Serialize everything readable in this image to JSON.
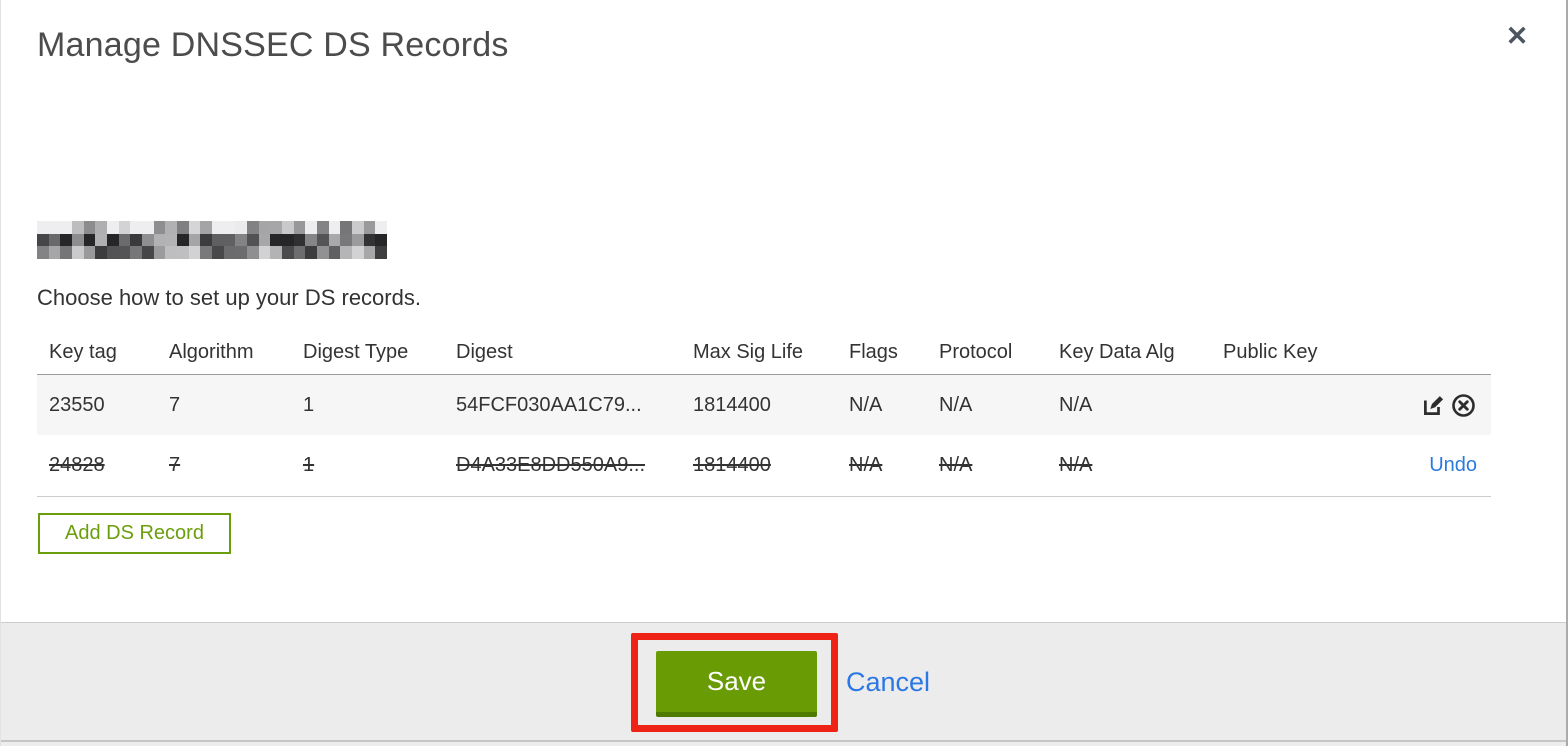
{
  "dialog": {
    "title": "Manage DNSSEC DS Records",
    "close_icon": "close",
    "subtitle": "Choose how to set up your DS records."
  },
  "table": {
    "columns": [
      "Key tag",
      "Algorithm",
      "Digest Type",
      "Digest",
      "Max Sig Life",
      "Flags",
      "Protocol",
      "Key Data Alg",
      "Public Key"
    ],
    "rows": [
      {
        "key_tag": "23550",
        "algorithm": "7",
        "digest_type": "1",
        "digest": "54FCF030AA1C79...",
        "max_sig_life": "1814400",
        "flags": "N/A",
        "protocol": "N/A",
        "key_data_alg": "N/A",
        "public_key": "",
        "state": "normal",
        "actions": [
          "edit",
          "delete"
        ]
      },
      {
        "key_tag": "24828",
        "algorithm": "7",
        "digest_type": "1",
        "digest": "D4A33E8DD550A9...",
        "max_sig_life": "1814400",
        "flags": "N/A",
        "protocol": "N/A",
        "key_data_alg": "N/A",
        "public_key": "",
        "state": "deleted",
        "undo_label": "Undo"
      }
    ]
  },
  "buttons": {
    "add_ds_record": "Add DS Record",
    "save": "Save",
    "cancel": "Cancel"
  },
  "colors": {
    "action_green": "#6b9e0c",
    "save_green": "#699b04",
    "save_green_dark": "#4e7a02",
    "link_blue": "#2b7bde",
    "annotation_red": "#ee2315",
    "row_alt_bg": "#f6f6f6",
    "footer_bg": "#ececec"
  }
}
